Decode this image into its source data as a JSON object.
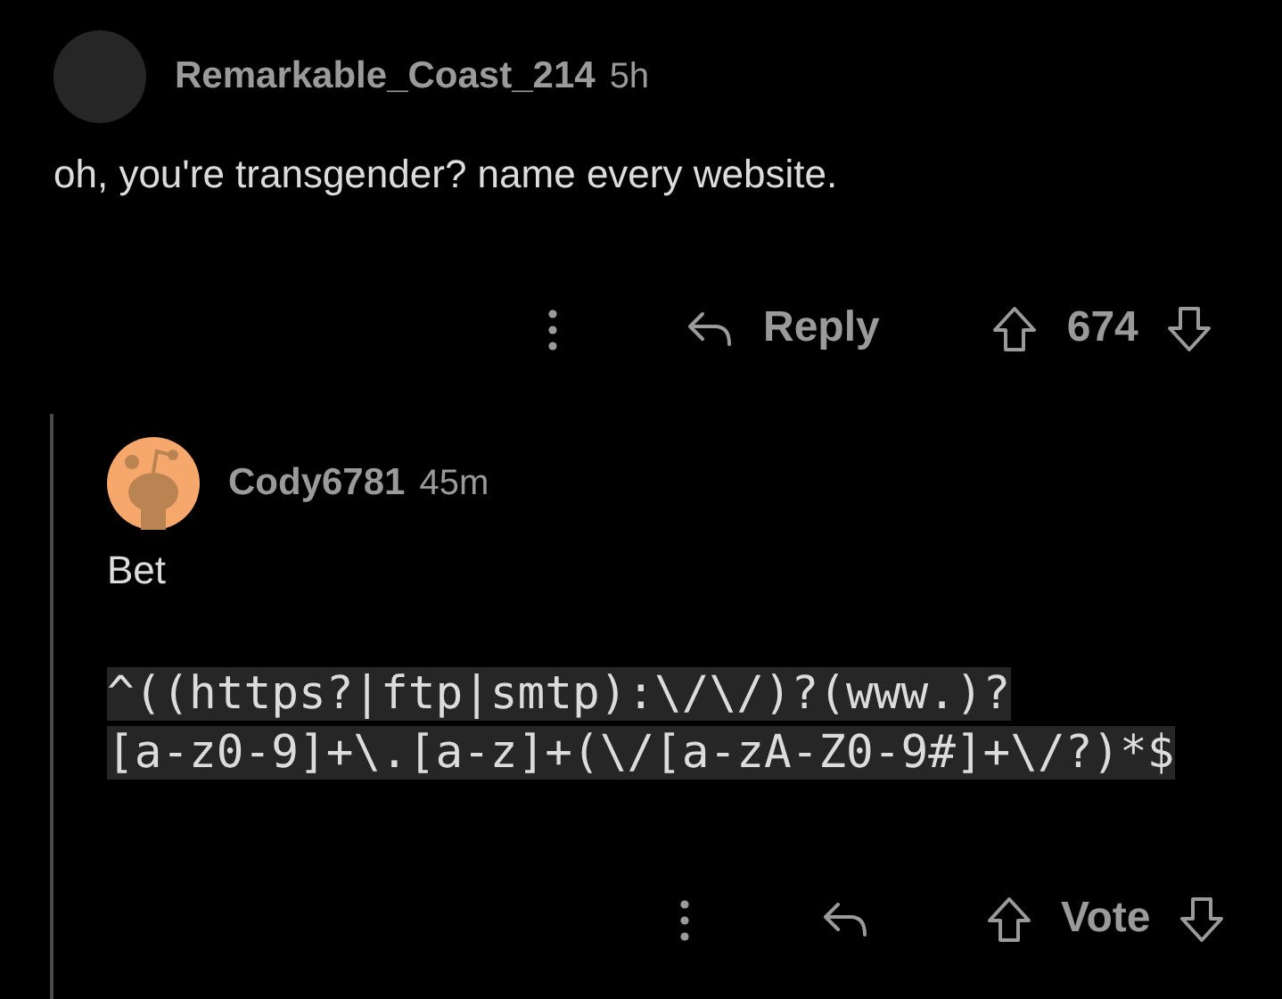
{
  "comments": [
    {
      "author": "Remarkable_Coast_214",
      "age": "5h",
      "kind": "plain",
      "body": [
        "oh, you're transgender? name every website."
      ],
      "reply_label": "Reply",
      "score": "674"
    },
    {
      "author": "Cody6781",
      "age": "45m",
      "kind": "mascot",
      "body": [
        "Bet"
      ],
      "code_lines": [
        "^((https?|ftp|smtp):\\/\\/)?(www.)?",
        "[a-z0-9]+\\.[a-z]+(\\/[a-zA-Z0-9#]+\\/?)*$"
      ],
      "score": "Vote"
    }
  ]
}
